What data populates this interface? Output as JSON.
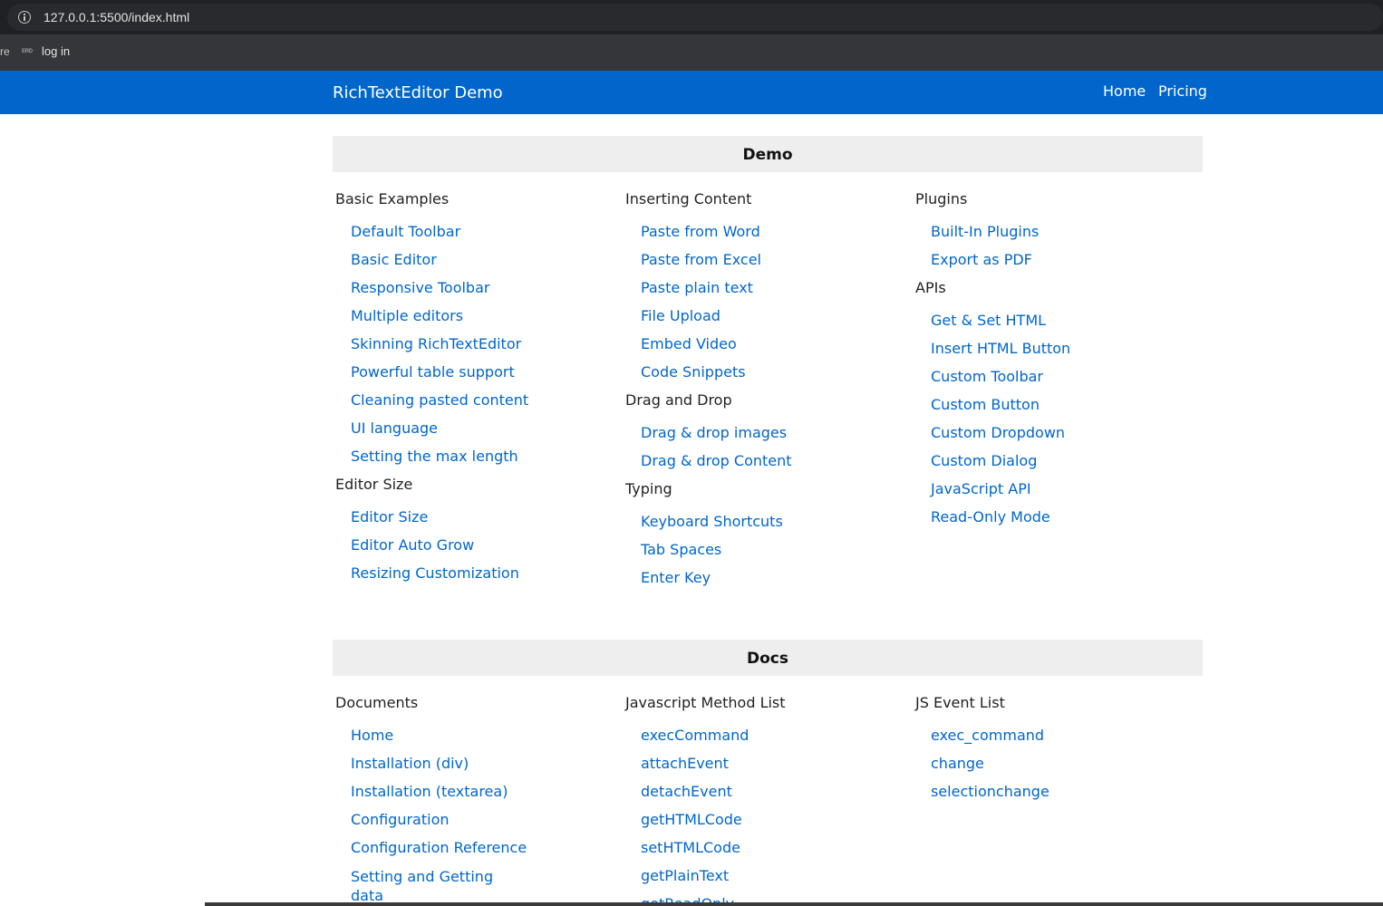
{
  "browser": {
    "url": "127.0.0.1:5500/index.html",
    "bookmark_clip": "re",
    "bookmark": {
      "favicon_text": "ERD",
      "label": "log in"
    }
  },
  "navbar": {
    "brand": "RichTextEditor Demo",
    "home": "Home",
    "pricing": "Pricing"
  },
  "demo": {
    "title": "Demo",
    "columns": [
      [
        {
          "title": "Basic Examples",
          "links": [
            "Default Toolbar",
            "Basic Editor",
            "Responsive Toolbar",
            "Multiple editors",
            "Skinning RichTextEditor",
            "Powerful table support",
            "Cleaning pasted content",
            "UI language",
            "Setting the max length"
          ]
        },
        {
          "title": "Editor Size",
          "links": [
            "Editor Size",
            "Editor Auto Grow",
            "Resizing Customization"
          ]
        }
      ],
      [
        {
          "title": "Inserting Content",
          "links": [
            "Paste from Word",
            "Paste from Excel",
            "Paste plain text",
            "File Upload",
            "Embed Video",
            "Code Snippets"
          ]
        },
        {
          "title": "Drag and Drop",
          "links": [
            "Drag & drop images",
            "Drag & drop Content"
          ]
        },
        {
          "title": "Typing",
          "links": [
            "Keyboard Shortcuts",
            "Tab Spaces",
            "Enter Key"
          ]
        }
      ],
      [
        {
          "title": "Plugins",
          "links": [
            "Built-In Plugins",
            "Export as PDF"
          ]
        },
        {
          "title": "APIs",
          "links": [
            "Get & Set HTML",
            "Insert HTML Button",
            "Custom Toolbar",
            "Custom Button",
            "Custom Dropdown",
            "Custom Dialog",
            "JavaScript API",
            "Read-Only Mode"
          ]
        }
      ]
    ]
  },
  "docs": {
    "title": "Docs",
    "columns": [
      [
        {
          "title": "Documents",
          "links": [
            "Home",
            "Installation (div)",
            "Installation (textarea)",
            "Configuration",
            "Configuration Reference",
            "Setting and Getting data"
          ]
        }
      ],
      [
        {
          "title": "Javascript Method List",
          "links": [
            "execCommand",
            "attachEvent",
            "detachEvent",
            "getHTMLCode",
            "setHTMLCode",
            "getPlainText",
            "getReadOnly"
          ]
        }
      ],
      [
        {
          "title": "JS Event List",
          "links": [
            "exec_command",
            "change",
            "selectionchange"
          ]
        }
      ]
    ]
  }
}
